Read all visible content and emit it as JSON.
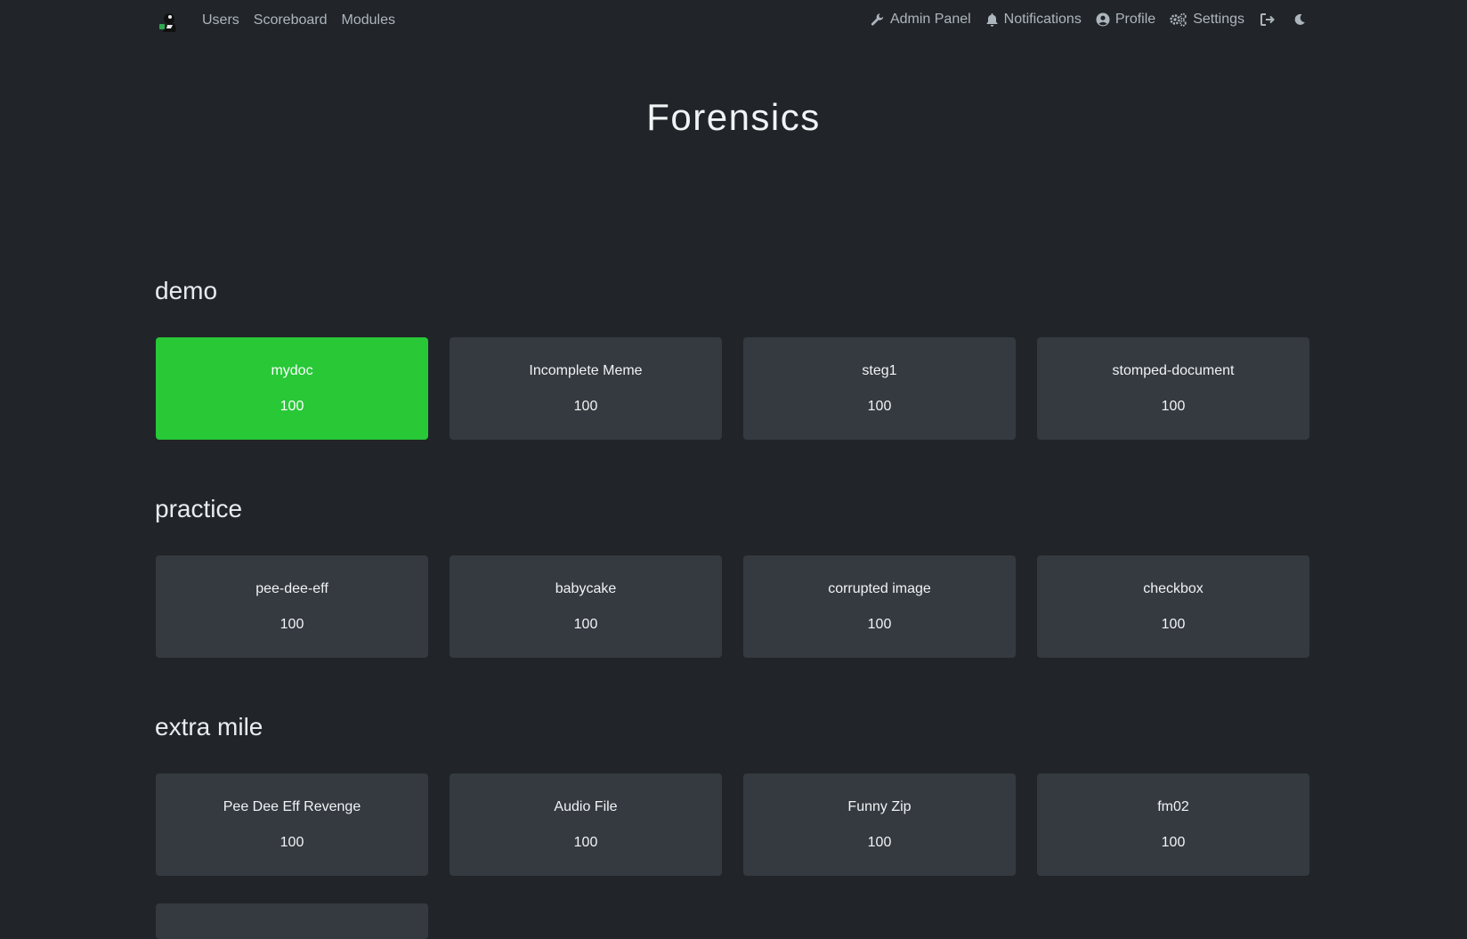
{
  "nav": {
    "left_links": [
      {
        "label": "Users"
      },
      {
        "label": "Scoreboard"
      },
      {
        "label": "Modules"
      }
    ],
    "right_links": [
      {
        "label": "Admin Panel",
        "icon": "wrench-icon"
      },
      {
        "label": "Notifications",
        "icon": "bell-icon"
      },
      {
        "label": "Profile",
        "icon": "user-circle-icon"
      },
      {
        "label": "Settings",
        "icon": "cogs-icon"
      }
    ],
    "logout_icon": "sign-out-icon",
    "theme_icon": "moon-icon"
  },
  "page": {
    "title": "Forensics"
  },
  "colors": {
    "background": "#212529",
    "card": "#343a40",
    "solved": "#28c837"
  },
  "categories": [
    {
      "name": "demo",
      "challenges": [
        {
          "name": "mydoc",
          "value": "100",
          "solved": true
        },
        {
          "name": "Incomplete Meme",
          "value": "100",
          "solved": false
        },
        {
          "name": "steg1",
          "value": "100",
          "solved": false
        },
        {
          "name": "stomped-document",
          "value": "100",
          "solved": false
        }
      ]
    },
    {
      "name": "practice",
      "challenges": [
        {
          "name": "pee-dee-eff",
          "value": "100",
          "solved": false
        },
        {
          "name": "babycake",
          "value": "100",
          "solved": false
        },
        {
          "name": "corrupted image",
          "value": "100",
          "solved": false
        },
        {
          "name": "checkbox",
          "value": "100",
          "solved": false
        }
      ]
    },
    {
      "name": "extra mile",
      "challenges": [
        {
          "name": "Pee Dee Eff Revenge",
          "value": "100",
          "solved": false
        },
        {
          "name": "Audio File",
          "value": "100",
          "solved": false
        },
        {
          "name": "Funny Zip",
          "value": "100",
          "solved": false
        },
        {
          "name": "fm02",
          "value": "100",
          "solved": false
        }
      ]
    }
  ]
}
